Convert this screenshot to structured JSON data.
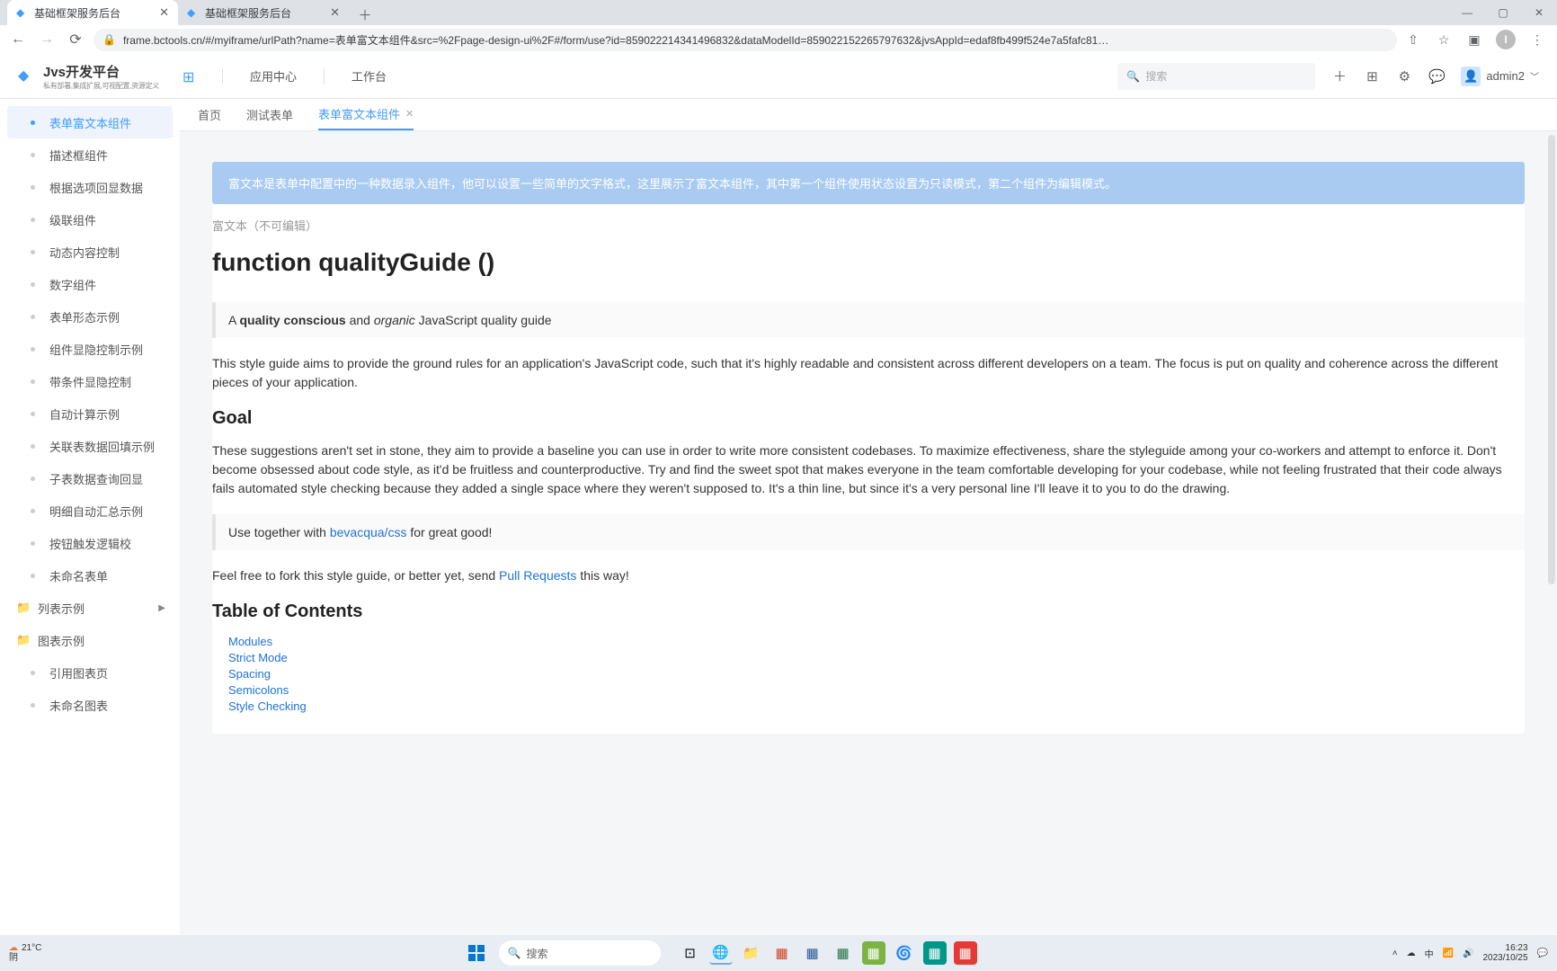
{
  "browser": {
    "tabs": [
      {
        "title": "基础框架服务后台",
        "active": true
      },
      {
        "title": "基础框架服务后台",
        "active": false
      }
    ],
    "url": "frame.bctools.cn/#/myiframe/urlPath?name=表单富文本组件&src=%2Fpage-design-ui%2F#/form/use?id=859022214341496832&dataModelId=859022152265797632&jvsAppId=edaf8fb499f524e7a5fafc81…",
    "avatar_letter": "I"
  },
  "header": {
    "logo_main": "Jvs开发平台",
    "logo_sub": "私有部署,集成扩展,可视配置,资源定义",
    "nav": {
      "app_center": "应用中心",
      "workbench": "工作台"
    },
    "search_placeholder": "搜索",
    "user_name": "admin2"
  },
  "sidebar": {
    "items": [
      "表单富文本组件",
      "描述框组件",
      "根据选项回显数据",
      "级联组件",
      "动态内容控制",
      "数字组件",
      "表单形态示例",
      "组件显隐控制示例",
      "带条件显隐控制",
      "自动计算示例",
      "关联表数据回填示例",
      "子表数据查询回显",
      "明细自动汇总示例",
      "按钮触发逻辑校",
      "未命名表单"
    ],
    "groups": [
      {
        "label": "列表示例",
        "expandable": true
      },
      {
        "label": "图表示例",
        "expandable": false,
        "children": [
          "引用图表页",
          "未命名图表"
        ]
      }
    ]
  },
  "inner_tabs": {
    "items": [
      {
        "label": "首页",
        "closable": false
      },
      {
        "label": "测试表单",
        "closable": false
      },
      {
        "label": "表单富文本组件",
        "closable": true,
        "active": true
      }
    ]
  },
  "content": {
    "banner": "富文本是表单中配置中的一种数据录入组件，他可以设置一些简单的文字格式，这里展示了富文本组件，其中第一个组件使用状态设置为只读模式，第二个组件为编辑模式。",
    "readonly_label": "富文本（不可编辑）",
    "h1": "function qualityGuide ()",
    "quote1_prefix": "A ",
    "quote1_bold": "quality conscious",
    "quote1_mid": " and ",
    "quote1_italic": "organic",
    "quote1_suffix": " JavaScript quality guide",
    "p1": "This style guide aims to provide the ground rules for an application's JavaScript code, such that it's highly readable and consistent across different developers on a team. The focus is put on quality and coherence across the different pieces of your application.",
    "h2_goal": "Goal",
    "p2": "These suggestions aren't set in stone, they aim to provide a baseline you can use in order to write more consistent codebases. To maximize effectiveness, share the styleguide among your co-workers and attempt to enforce it. Don't become obsessed about code style, as it'd be fruitless and counterproductive. Try and find the sweet spot that makes everyone in the team comfortable developing for your codebase, while not feeling frustrated that their code always fails automated style checking because they added a single space where they weren't supposed to. It's a thin line, but since it's a very personal line I'll leave it to you to do the drawing.",
    "quote2_prefix": "Use together with ",
    "quote2_link": "bevacqua/css",
    "quote2_suffix": " for great good!",
    "p3_prefix": "Feel free to fork this style guide, or better yet, send ",
    "p3_link": "Pull Requests",
    "p3_suffix": " this way!",
    "h2_toc": "Table of Contents",
    "toc": [
      "Modules",
      "Strict Mode",
      "Spacing",
      "Semicolons",
      "Style Checking"
    ]
  },
  "taskbar": {
    "temp": "21°C",
    "weather": "阴",
    "search_placeholder": "搜索",
    "time": "16:23",
    "date": "2023/10/25"
  }
}
